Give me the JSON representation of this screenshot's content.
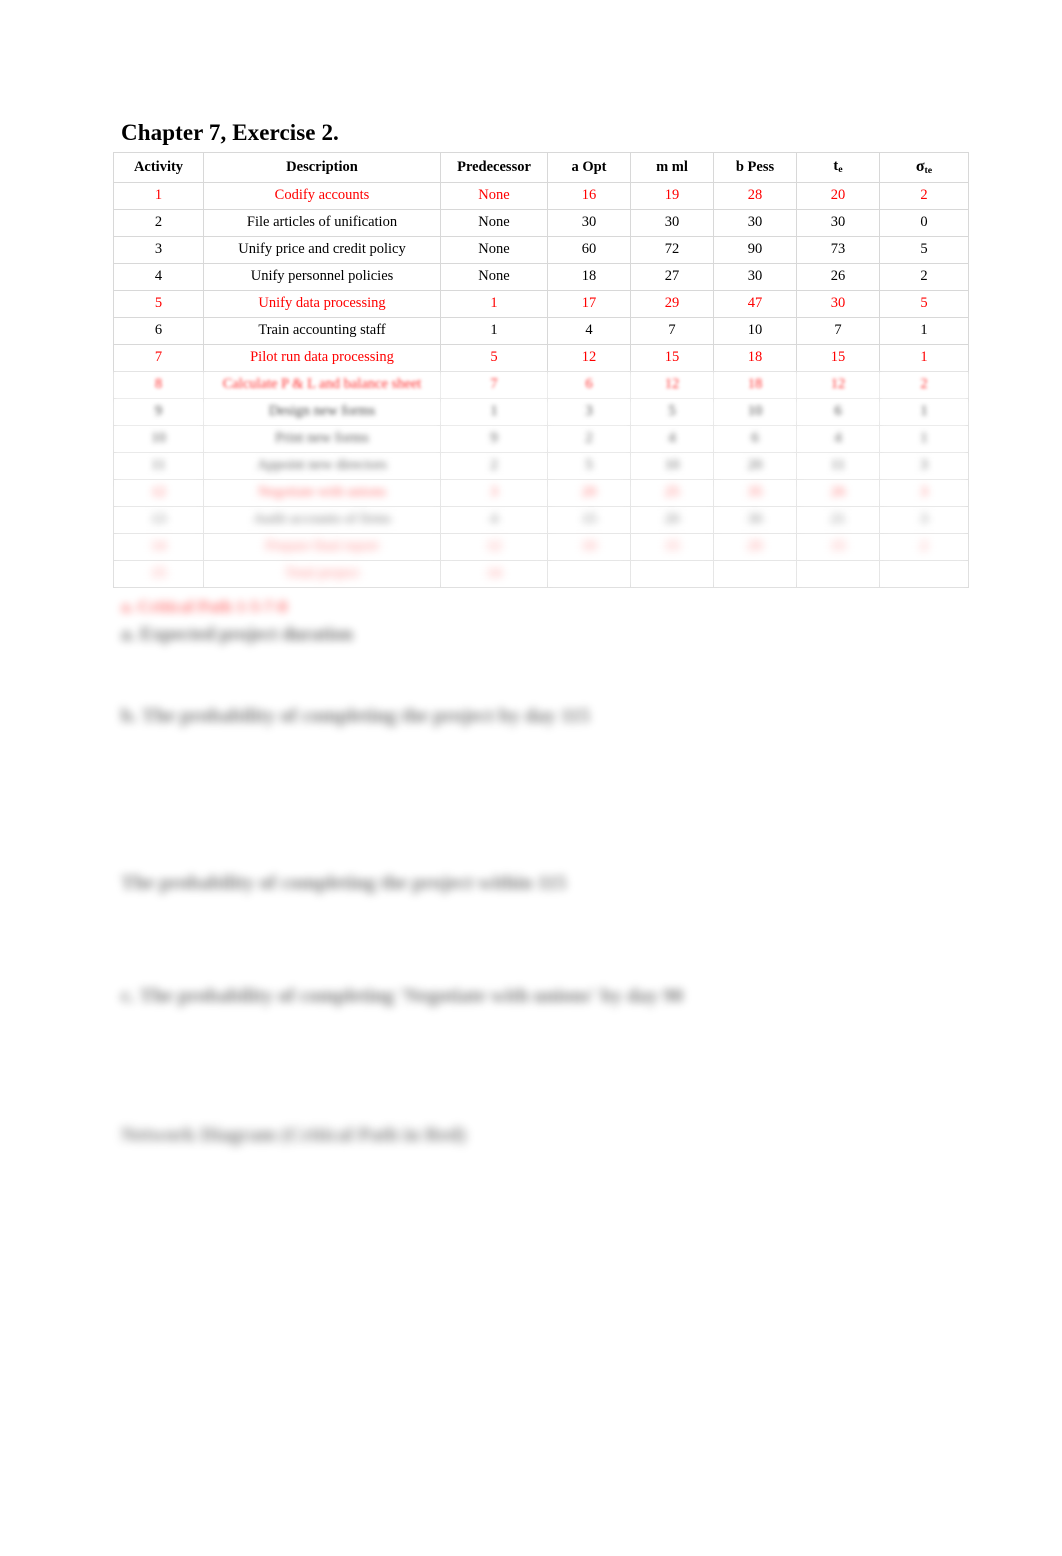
{
  "document": {
    "title": "Chapter 7, Exercise 2.",
    "accent_red": "#ff0000",
    "text_color": "#000000"
  },
  "table": {
    "headers": {
      "activity": "Activity",
      "description": "Description",
      "predecessor": "Predecessor",
      "a_opt": "a Opt",
      "m_ml": "m ml",
      "b_pess": "b Pess",
      "te": "t",
      "te_sub": "e",
      "sigma": "σ",
      "sigma_sub": "te"
    },
    "rows": [
      {
        "activity": "1",
        "description": "Codify accounts",
        "predecessor": "None",
        "a": "16",
        "m": "19",
        "b": "28",
        "te": "20",
        "sigma": "2",
        "highlight": true,
        "blur": 0
      },
      {
        "activity": "2",
        "description": "File articles of unification",
        "predecessor": "None",
        "a": "30",
        "m": "30",
        "b": "30",
        "te": "30",
        "sigma": "0",
        "highlight": false,
        "blur": 0
      },
      {
        "activity": "3",
        "description": "Unify price and credit policy",
        "predecessor": "None",
        "a": "60",
        "m": "72",
        "b": "90",
        "te": "73",
        "sigma": "5",
        "highlight": false,
        "blur": 0
      },
      {
        "activity": "4",
        "description": "Unify personnel policies",
        "predecessor": "None",
        "a": "18",
        "m": "27",
        "b": "30",
        "te": "26",
        "sigma": "2",
        "highlight": false,
        "blur": 0
      },
      {
        "activity": "5",
        "description": "Unify data processing",
        "predecessor": "1",
        "a": "17",
        "m": "29",
        "b": "47",
        "te": "30",
        "sigma": "5",
        "highlight": true,
        "blur": 0
      },
      {
        "activity": "6",
        "description": "Train accounting staff",
        "predecessor": "1",
        "a": "4",
        "m": "7",
        "b": "10",
        "te": "7",
        "sigma": "1",
        "highlight": false,
        "blur": 0
      },
      {
        "activity": "7",
        "description": "Pilot run data processing",
        "predecessor": "5",
        "a": "12",
        "m": "15",
        "b": "18",
        "te": "15",
        "sigma": "1",
        "highlight": true,
        "blur": 0
      },
      {
        "activity": "8",
        "description": "Calculate P & L and balance sheet",
        "predecessor": "7",
        "a": "6",
        "m": "12",
        "b": "18",
        "te": "12",
        "sigma": "2",
        "highlight": true,
        "blur": 1
      },
      {
        "activity": "9",
        "description": "Design new forms",
        "predecessor": "1",
        "a": "3",
        "m": "5",
        "b": "10",
        "te": "6",
        "sigma": "1",
        "highlight": false,
        "blur": 2
      },
      {
        "activity": "10",
        "description": "Print new forms",
        "predecessor": "9",
        "a": "2",
        "m": "4",
        "b": "6",
        "te": "4",
        "sigma": "1",
        "highlight": false,
        "blur": 3
      },
      {
        "activity": "11",
        "description": "Appoint new directors",
        "predecessor": "2",
        "a": "5",
        "m": "10",
        "b": "20",
        "te": "11",
        "sigma": "3",
        "highlight": false,
        "blur": 4
      },
      {
        "activity": "12",
        "description": "Negotiate with unions",
        "predecessor": "3",
        "a": "20",
        "m": "25",
        "b": "35",
        "te": "26",
        "sigma": "3",
        "highlight": true,
        "blur": 5
      },
      {
        "activity": "13",
        "description": "Audit accounts of firms",
        "predecessor": "4",
        "a": "15",
        "m": "20",
        "b": "30",
        "te": "21",
        "sigma": "3",
        "highlight": false,
        "blur": 6
      },
      {
        "activity": "14",
        "description": "Prepare final report",
        "predecessor": "12",
        "a": "10",
        "m": "15",
        "b": "20",
        "te": "15",
        "sigma": "2",
        "highlight": true,
        "blur": 7
      },
      {
        "activity": "15",
        "description": "Total project",
        "predecessor": "14",
        "a": "",
        "m": "",
        "b": "",
        "te": "",
        "sigma": "",
        "highlight": true,
        "blur": 7
      }
    ]
  },
  "paragraphs": {
    "a": "a. Critical Path 1-5-7-8",
    "b": "a. Expected project duration",
    "c": "b. The probability of completing the project by day 115",
    "d": "The probability of completing the project within 115",
    "e": "c. The probability of completing 'Negotiate with unions' by day 90",
    "f": "Network Diagram (Critical Path in Red)"
  }
}
